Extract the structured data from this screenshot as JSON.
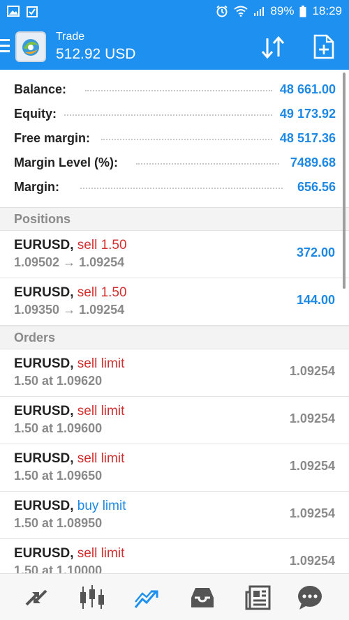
{
  "status_bar": {
    "battery": "89%",
    "time": "18:29",
    "icons": [
      "gallery-icon",
      "checkbox-icon",
      "alarm-icon",
      "wifi-icon",
      "signal-icon",
      "battery-icon"
    ]
  },
  "app_bar": {
    "title": "Trade",
    "subtitle": "512.92 USD",
    "icons": [
      "menu-icon",
      "sort-icon",
      "new-order-icon"
    ]
  },
  "summary": [
    {
      "label": "Balance:",
      "value": "48 661.00"
    },
    {
      "label": "Equity:",
      "value": "49 173.92"
    },
    {
      "label": "Free margin:",
      "value": "48 517.36"
    },
    {
      "label": "Margin Level (%):",
      "value": "7489.68"
    },
    {
      "label": "Margin:",
      "value": "656.56"
    }
  ],
  "positions": {
    "header": "Positions",
    "items": [
      {
        "symbol": "EURUSD,",
        "side": "sell 1.50",
        "prices": "1.09502 → 1.09254",
        "profit": "372.00"
      },
      {
        "symbol": "EURUSD,",
        "side": "sell 1.50",
        "prices": "1.09350 → 1.09254",
        "profit": "144.00"
      }
    ]
  },
  "orders": {
    "header": "Orders",
    "items": [
      {
        "symbol": "EURUSD,",
        "side": "sell limit",
        "details": "1.50 at 1.09620",
        "price": "1.09254"
      },
      {
        "symbol": "EURUSD,",
        "side": "sell limit",
        "details": "1.50 at 1.09600",
        "price": "1.09254"
      },
      {
        "symbol": "EURUSD,",
        "side": "sell limit",
        "details": "1.50 at 1.09650",
        "price": "1.09254"
      },
      {
        "symbol": "EURUSD,",
        "side": "buy limit",
        "details": "1.50 at 1.08950",
        "price": "1.09254"
      },
      {
        "symbol": "EURUSD,",
        "side": "sell limit",
        "details": "1.50 at 1.10000",
        "price": "1.09254"
      }
    ]
  },
  "bottom_nav": {
    "icons": [
      "quotes-icon",
      "chart-icon",
      "trade-icon",
      "history-icon",
      "news-icon",
      "chat-icon"
    ],
    "active": "trade-icon"
  },
  "colors": {
    "primary": "#1e90f0",
    "sell": "#d32f2f",
    "buy": "#1e88e5",
    "value": "#1e88e5",
    "muted": "#8a8a8a"
  }
}
